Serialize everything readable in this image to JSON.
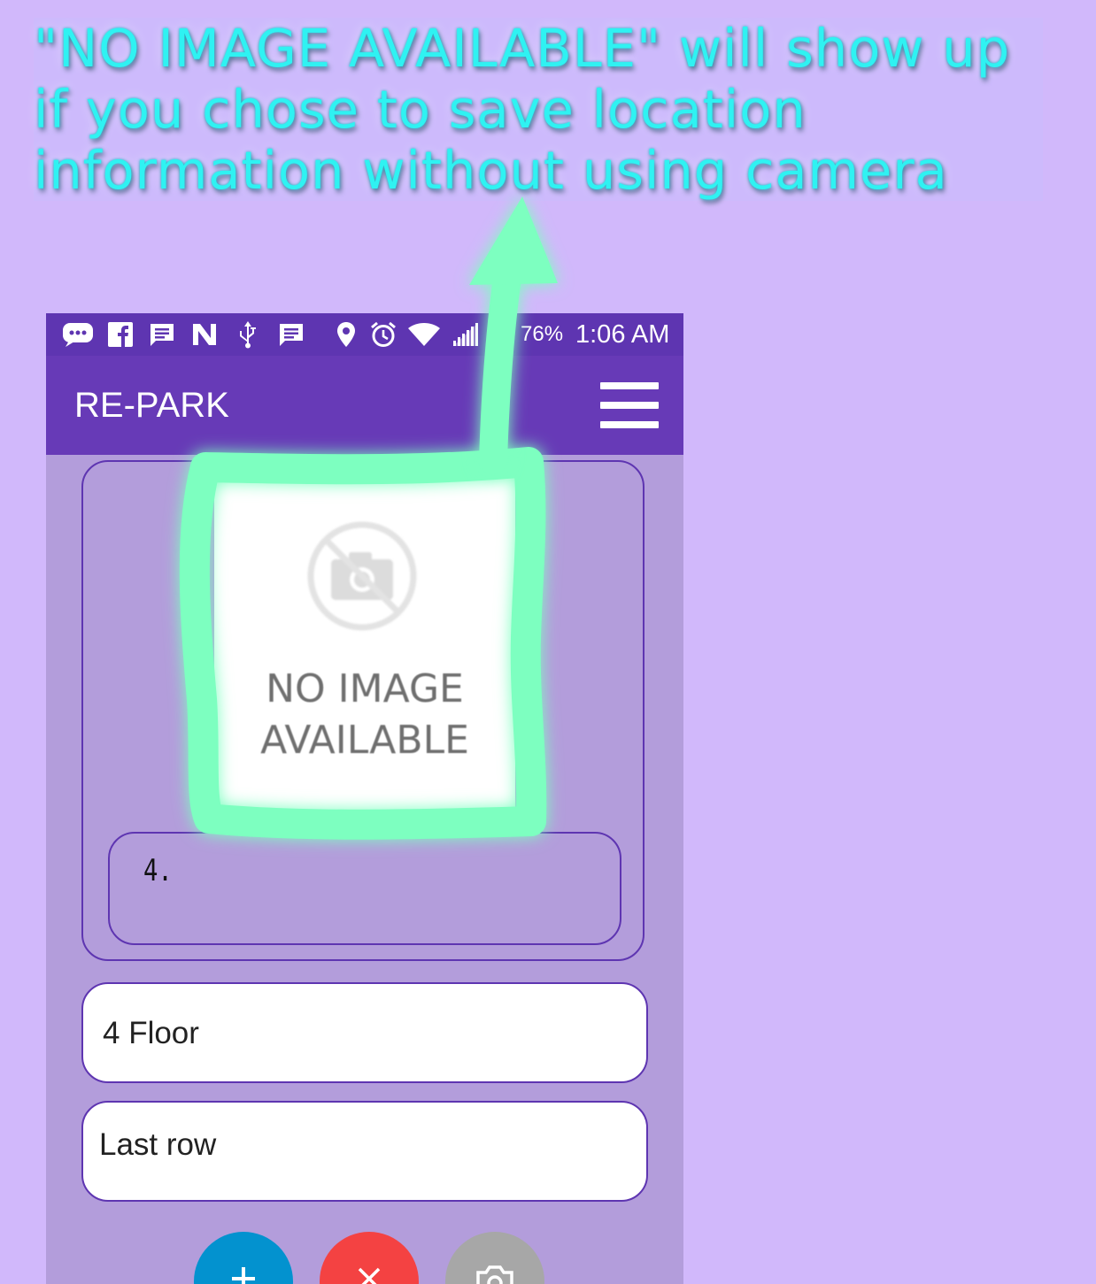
{
  "annotation": {
    "text": "\"NO IMAGE AVAILABLE\" will show up if you chose to save location information without using camera"
  },
  "status_bar": {
    "battery": "76%",
    "time": "1:06 AM",
    "icons": [
      "chat-bubble-icon",
      "facebook-icon",
      "message-icon",
      "nfc-icon",
      "usb-icon",
      "message-icon",
      "location-pin-icon",
      "alarm-icon",
      "wifi-icon",
      "signal-icon",
      "battery-icon"
    ]
  },
  "app_bar": {
    "title": "RE-PARK",
    "menu_icon": "hamburger-menu-icon"
  },
  "card": {
    "image_placeholder": {
      "line1": "NO IMAGE",
      "line2": "AVAILABLE",
      "icon": "no-camera-icon"
    },
    "note": "4."
  },
  "fields": {
    "floor": "4 Floor",
    "row": "Last row"
  },
  "actions": [
    {
      "name": "add",
      "icon": "plus-icon",
      "color": "#0392cf"
    },
    {
      "name": "cancel",
      "icon": "close-icon",
      "color": "#f44242"
    },
    {
      "name": "camera",
      "icon": "camera-icon",
      "color": "#a7a7a7"
    }
  ],
  "colors": {
    "page_background": "#d1b8fb",
    "annotation_text": "#2ff2f2",
    "highlight": "#7dffc0",
    "status_bar": "#5e35b1",
    "app_bar": "#673ab7",
    "content_background": "#b39ddb",
    "border": "#5e35b1"
  }
}
